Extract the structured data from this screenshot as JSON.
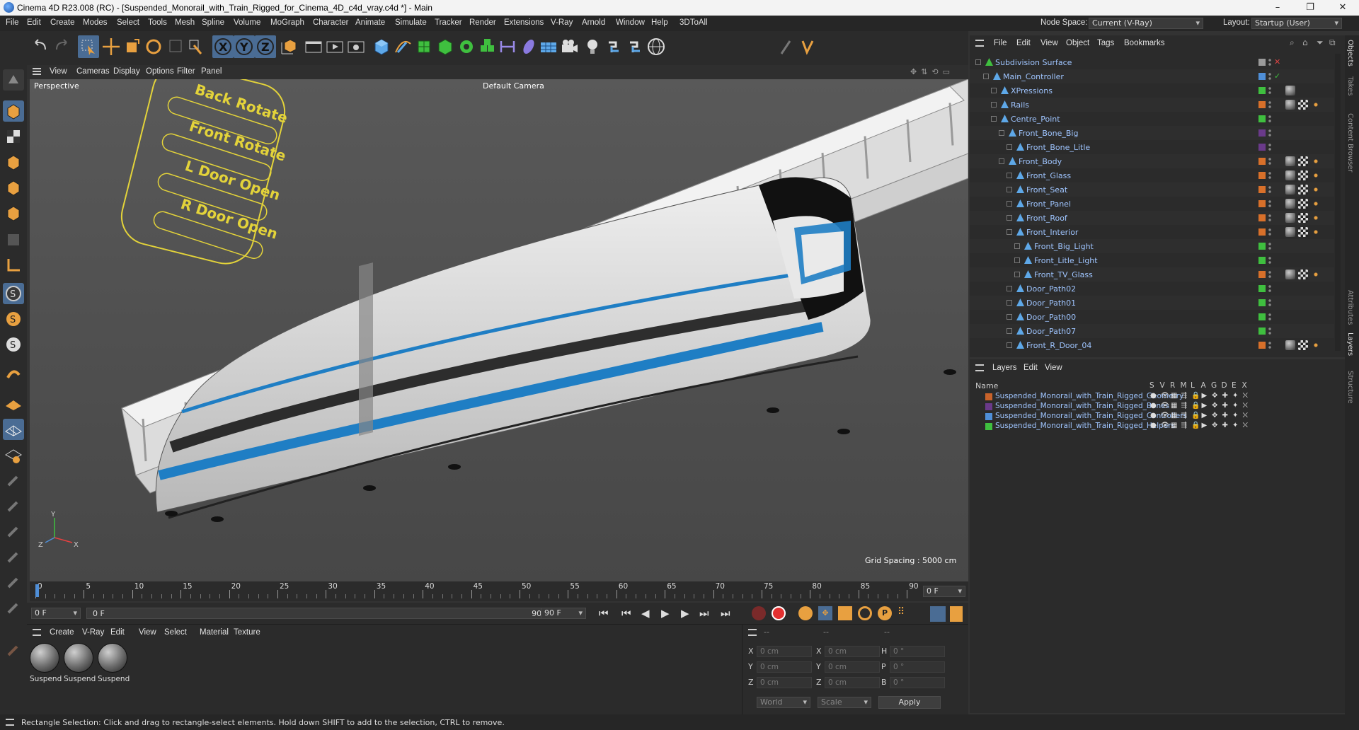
{
  "window": {
    "title": "Cinema 4D R23.008 (RC) - [Suspended_Monorail_with_Train_Rigged_for_Cinema_4D_c4d_vray.c4d *] - Main"
  },
  "menubar": {
    "items": [
      "File",
      "Edit",
      "Create",
      "Modes",
      "Select",
      "Tools",
      "Mesh",
      "Spline",
      "Volume",
      "MoGraph",
      "Character",
      "Animate",
      "Simulate",
      "Tracker",
      "Render",
      "Extensions",
      "V-Ray",
      "Arnold",
      "Window",
      "Help",
      "3DToAll"
    ],
    "node_space_label": "Node Space:",
    "node_space_value": "Current (V-Ray)",
    "layout_label": "Layout:",
    "layout_value": "Startup (User)"
  },
  "viewport": {
    "menu": [
      "Cameras",
      "Display",
      "Options",
      "Filter",
      "Panel"
    ],
    "view_label": "View",
    "name": "Perspective",
    "camera": "Default Camera",
    "grid_spacing": "Grid Spacing : 5000 cm",
    "controller_labels": [
      "Back Rotate",
      "Front Rotate",
      "L Door Open",
      "R Door Open"
    ],
    "axis": {
      "x": "X",
      "y": "Y",
      "z": "Z"
    }
  },
  "timeline": {
    "ticks": [
      "0",
      "5",
      "10",
      "15",
      "20",
      "25",
      "30",
      "35",
      "40",
      "45",
      "50",
      "55",
      "60",
      "65",
      "70",
      "75",
      "80",
      "85",
      "90"
    ],
    "end_frame": "0 F"
  },
  "time_controls": {
    "start_field": "0 F",
    "current_field": "0 F",
    "range_end": "90 F",
    "end_field": "90 F"
  },
  "materials": {
    "menu": [
      "Create",
      "V-Ray",
      "Edit",
      "View",
      "Select",
      "Material",
      "Texture"
    ],
    "items": [
      "Suspend",
      "Suspend",
      "Suspend"
    ]
  },
  "coordinates": {
    "header": [
      "--",
      "--",
      "--"
    ],
    "rows": [
      {
        "axis": "X",
        "pos": "0 cm",
        "axis2": "X",
        "size": "0 cm",
        "rot_label": "H",
        "rot": "0 °"
      },
      {
        "axis": "Y",
        "pos": "0 cm",
        "axis2": "Y",
        "size": "0 cm",
        "rot_label": "P",
        "rot": "0 °"
      },
      {
        "axis": "Z",
        "pos": "0 cm",
        "axis2": "Z",
        "size": "0 cm",
        "rot_label": "B",
        "rot": "0 °"
      }
    ],
    "space": "World",
    "mode": "Scale",
    "apply": "Apply"
  },
  "objects_panel": {
    "menu": [
      "File",
      "Edit",
      "View",
      "Object",
      "Tags",
      "Bookmarks"
    ],
    "rows": [
      {
        "name": "Subdivision Surface",
        "indent": 0,
        "color": "#9a9a9a",
        "tags": 0
      },
      {
        "name": "Main_Controller",
        "indent": 1,
        "color": "#4f8fd8",
        "tags": 0
      },
      {
        "name": "XPressions",
        "indent": 2,
        "color": "#3fbf3f",
        "tags": 1
      },
      {
        "name": "Rails",
        "indent": 2,
        "color": "#d8702a",
        "tags": 3
      },
      {
        "name": "Centre_Point",
        "indent": 2,
        "color": "#3fbf3f",
        "tags": 0
      },
      {
        "name": "Front_Bone_Big",
        "indent": 3,
        "color": "#6a3a8a",
        "tags": 0
      },
      {
        "name": "Front_Bone_Litle",
        "indent": 4,
        "color": "#6a3a8a",
        "tags": 0
      },
      {
        "name": "Front_Body",
        "indent": 3,
        "color": "#d8702a",
        "tags": 3
      },
      {
        "name": "Front_Glass",
        "indent": 4,
        "color": "#d8702a",
        "tags": 3
      },
      {
        "name": "Front_Seat",
        "indent": 4,
        "color": "#d8702a",
        "tags": 3
      },
      {
        "name": "Front_Panel",
        "indent": 4,
        "color": "#d8702a",
        "tags": 3
      },
      {
        "name": "Front_Roof",
        "indent": 4,
        "color": "#d8702a",
        "tags": 3
      },
      {
        "name": "Front_Interior",
        "indent": 4,
        "color": "#d8702a",
        "tags": 3
      },
      {
        "name": "Front_Big_Light",
        "indent": 5,
        "color": "#3fbf3f",
        "tags": 0
      },
      {
        "name": "Front_Litle_Light",
        "indent": 5,
        "color": "#3fbf3f",
        "tags": 0
      },
      {
        "name": "Front_TV_Glass",
        "indent": 5,
        "color": "#d8702a",
        "tags": 3
      },
      {
        "name": "Door_Path02",
        "indent": 4,
        "color": "#3fbf3f",
        "tags": 0
      },
      {
        "name": "Door_Path01",
        "indent": 4,
        "color": "#3fbf3f",
        "tags": 0
      },
      {
        "name": "Door_Path00",
        "indent": 4,
        "color": "#3fbf3f",
        "tags": 0
      },
      {
        "name": "Door_Path07",
        "indent": 4,
        "color": "#3fbf3f",
        "tags": 0
      },
      {
        "name": "Front_R_Door_04",
        "indent": 4,
        "color": "#d8702a",
        "tags": 3
      }
    ]
  },
  "layers_panel": {
    "menu": [
      "Layers",
      "Edit",
      "View"
    ],
    "name_header": "Name",
    "col_headers": [
      "S",
      "V",
      "R",
      "M",
      "L",
      "A",
      "G",
      "D",
      "E",
      "X"
    ],
    "rows": [
      {
        "name": "Suspended_Monorail_with_Train_Rigged_Geometry",
        "color": "#c8622a"
      },
      {
        "name": "Suspended_Monorail_with_Train_Rigged_Bones",
        "color": "#6a3a8a"
      },
      {
        "name": "Suspended_Monorail_with_Train_Rigged_Controllers",
        "color": "#4f8fd8"
      },
      {
        "name": "Suspended_Monorail_with_Train_Rigged_Helpers",
        "color": "#3fbf3f"
      }
    ]
  },
  "right_tabs": [
    "Objects",
    "Takes",
    "Content Browser",
    "Attributes",
    "Layers",
    "Structure"
  ],
  "status": {
    "text": "Rectangle Selection: Click and drag to rectangle-select elements. Hold down SHIFT to add to the selection, CTRL to remove."
  }
}
